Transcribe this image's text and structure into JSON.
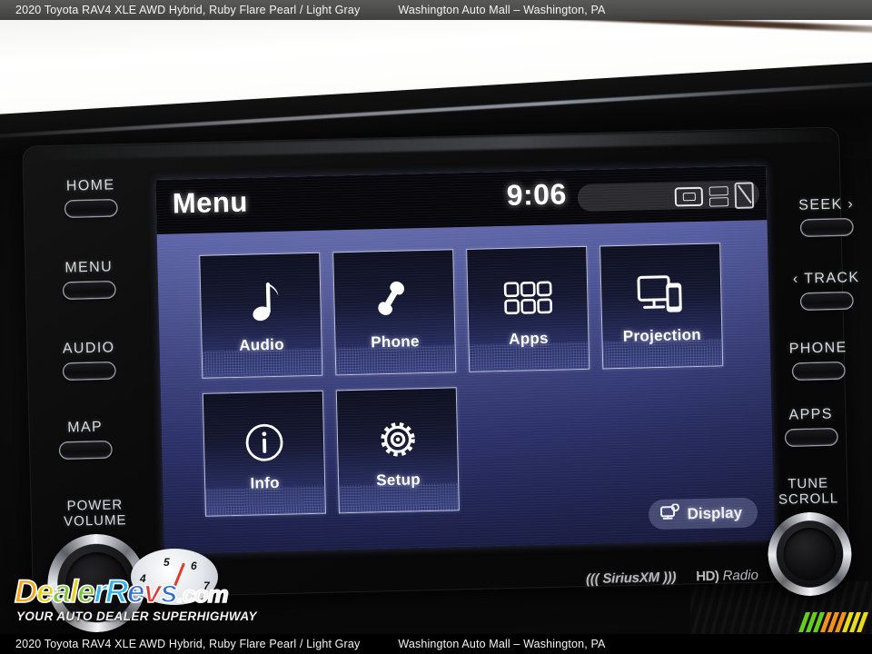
{
  "caption": {
    "vehicle": "2020 Toyota RAV4 XLE AWD Hybrid,  Ruby Flare Pearl / Light Gray",
    "dealer": "Washington Auto Mall – Washington, PA"
  },
  "screen": {
    "title": "Menu",
    "clock": "9:06",
    "status_icons": [
      "media-card-icon",
      "stacked-card-icon",
      "no-signal-icon"
    ],
    "tiles": [
      {
        "id": "audio",
        "label": "Audio",
        "icon": "music-note-icon"
      },
      {
        "id": "phone",
        "label": "Phone",
        "icon": "phone-handset-icon"
      },
      {
        "id": "apps",
        "label": "Apps",
        "icon": "app-grid-icon"
      },
      {
        "id": "projection",
        "label": "Projection",
        "icon": "screen-mirroring-icon"
      },
      {
        "id": "info",
        "label": "Info",
        "icon": "info-circle-icon"
      },
      {
        "id": "setup",
        "label": "Setup",
        "icon": "gear-icon"
      }
    ],
    "display_button": {
      "label": "Display",
      "icon": "monitor-gear-icon"
    }
  },
  "hardware": {
    "left_buttons": [
      {
        "label": "HOME"
      },
      {
        "label": "MENU"
      },
      {
        "label": "AUDIO"
      },
      {
        "label": "MAP"
      }
    ],
    "right_buttons": [
      {
        "label": "SEEK ›"
      },
      {
        "label": "‹ TRACK"
      },
      {
        "label": "PHONE"
      },
      {
        "label": "APPS"
      }
    ],
    "left_knob": {
      "line1": "POWER",
      "line2": "VOLUME"
    },
    "right_knob": {
      "line1": "TUNE",
      "line2": "SCROLL"
    }
  },
  "branding": {
    "siriusxm": "((( SiriusXM )))",
    "hdradio_mark": "HD)",
    "hdradio_word": "Radio"
  },
  "watermark": {
    "name_parts": [
      "D",
      "e",
      "a",
      "l",
      "e",
      "r",
      "R",
      "e",
      "v",
      "s"
    ],
    "suffix": ".com",
    "tagline": "YOUR AUTO DEALER SUPERHIGHWAY",
    "gauge_numbers": [
      "4",
      "5",
      "6",
      "7"
    ]
  },
  "colors": {
    "screen_blue": "#3f4684",
    "tile_border": "#e2e6fa",
    "accent_white": "#ffffff",
    "bar_green": "#66cc22",
    "bar_orange": "#f2921a",
    "bar_yellow": "#e8dc18"
  }
}
